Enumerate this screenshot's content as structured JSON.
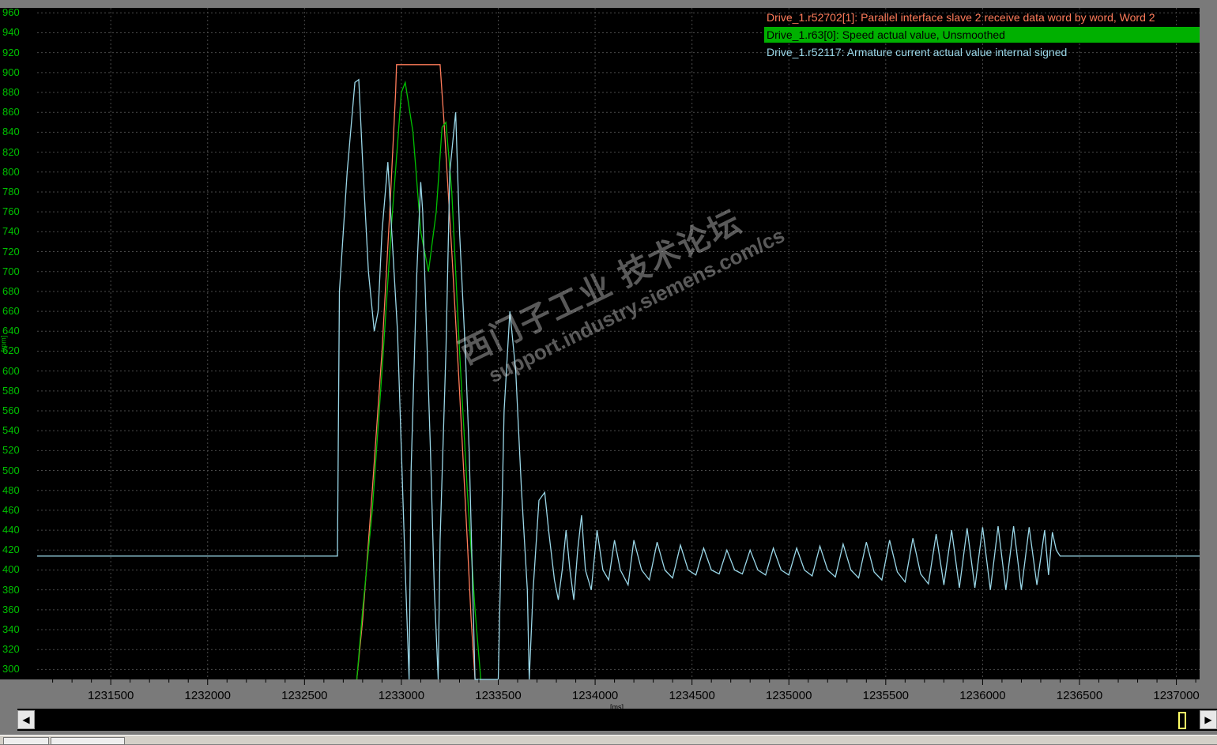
{
  "legend": [
    {
      "label": "Drive_1.r52702[1]: Parallel interface slave 2 receive data word by word, Word 2",
      "color": "#ff7b5a",
      "selected": false
    },
    {
      "label": "Drive_1.r63[0]: Speed actual value, Unsmoothed",
      "color": "#00c000",
      "selected": true
    },
    {
      "label": "Drive_1.r52117: Armature current actual value internal signed",
      "color": "#9ad7e8",
      "selected": false
    }
  ],
  "axes": {
    "y_unit": "[rpm]",
    "x_unit": "[ms]",
    "y_ticks": [
      "960",
      "940",
      "920",
      "900",
      "880",
      "860",
      "840",
      "820",
      "800",
      "780",
      "760",
      "740",
      "720",
      "700",
      "680",
      "660",
      "640",
      "620",
      "600",
      "580",
      "560",
      "540",
      "520",
      "500",
      "480",
      "460",
      "440",
      "420",
      "400",
      "380",
      "360",
      "340",
      "320",
      "300"
    ],
    "x_ticks": [
      "1231500",
      "1232000",
      "1232500",
      "1233000",
      "1233500",
      "1234000",
      "1234500",
      "1235000",
      "1235500",
      "1236000",
      "1236500",
      "1237000"
    ]
  },
  "watermark": {
    "line1": "西门子工业 技术论坛",
    "line2": "support.industry.siemens.com/cs"
  },
  "scrollbar": {
    "left_arrow": "◀",
    "right_arrow": "▶"
  },
  "colors": {
    "plot_bg": "#000000",
    "grid": "#4a4a4a",
    "axis_text": "#00c000",
    "selected_bg": "#00b000"
  },
  "chart_data": {
    "type": "line",
    "xlabel": "[ms]",
    "ylabel": "[rpm]",
    "xlim": [
      1231120,
      1237120
    ],
    "ylim": [
      290,
      965
    ],
    "grid": true,
    "legend_position": "top-right",
    "series": [
      {
        "name": "Drive_1.r52702[1]: Parallel interface slave 2 receive data word by word, Word 2",
        "color": "#ff7b5a",
        "points": [
          [
            1232770,
            290
          ],
          [
            1232800,
            350
          ],
          [
            1232850,
            480
          ],
          [
            1232900,
            620
          ],
          [
            1232940,
            760
          ],
          [
            1232970,
            880
          ],
          [
            1232975,
            908
          ],
          [
            1233000,
            908
          ],
          [
            1233100,
            908
          ],
          [
            1233200,
            908
          ],
          [
            1233220,
            850
          ],
          [
            1233260,
            720
          ],
          [
            1233300,
            580
          ],
          [
            1233340,
            430
          ],
          [
            1233360,
            350
          ],
          [
            1233380,
            290
          ]
        ]
      },
      {
        "name": "Drive_1.r63[0]: Speed actual value, Unsmoothed",
        "color": "#00c000",
        "points": [
          [
            1232770,
            290
          ],
          [
            1232800,
            360
          ],
          [
            1232850,
            460
          ],
          [
            1232900,
            600
          ],
          [
            1232950,
            750
          ],
          [
            1233000,
            880
          ],
          [
            1233020,
            890
          ],
          [
            1233060,
            840
          ],
          [
            1233100,
            740
          ],
          [
            1233140,
            700
          ],
          [
            1233180,
            760
          ],
          [
            1233210,
            845
          ],
          [
            1233230,
            850
          ],
          [
            1233260,
            780
          ],
          [
            1233300,
            620
          ],
          [
            1233340,
            480
          ],
          [
            1233380,
            360
          ],
          [
            1233410,
            290
          ]
        ]
      },
      {
        "name": "Drive_1.r52117: Armature current actual value internal signed",
        "color": "#9ad7e8",
        "points": [
          [
            1231120,
            414
          ],
          [
            1232300,
            414
          ],
          [
            1232670,
            414
          ],
          [
            1232680,
            680
          ],
          [
            1232720,
            800
          ],
          [
            1232760,
            890
          ],
          [
            1232780,
            893
          ],
          [
            1232800,
            810
          ],
          [
            1232830,
            700
          ],
          [
            1232860,
            640
          ],
          [
            1232880,
            660
          ],
          [
            1232900,
            740
          ],
          [
            1232930,
            810
          ],
          [
            1232950,
            740
          ],
          [
            1232980,
            640
          ],
          [
            1233000,
            520
          ],
          [
            1233020,
            400
          ],
          [
            1233040,
            290
          ],
          [
            1233050,
            500
          ],
          [
            1233080,
            700
          ],
          [
            1233100,
            790
          ],
          [
            1233110,
            760
          ],
          [
            1233130,
            640
          ],
          [
            1233150,
            520
          ],
          [
            1233170,
            380
          ],
          [
            1233190,
            290
          ],
          [
            1233200,
            430
          ],
          [
            1233230,
            620
          ],
          [
            1233250,
            800
          ],
          [
            1233280,
            860
          ],
          [
            1233300,
            740
          ],
          [
            1233330,
            620
          ],
          [
            1233350,
            520
          ],
          [
            1233380,
            290
          ],
          [
            1233500,
            290
          ],
          [
            1233530,
            560
          ],
          [
            1233560,
            660
          ],
          [
            1233590,
            600
          ],
          [
            1233620,
            480
          ],
          [
            1233650,
            380
          ],
          [
            1233660,
            290
          ],
          [
            1233680,
            380
          ],
          [
            1233710,
            470
          ],
          [
            1233740,
            478
          ],
          [
            1233760,
            440
          ],
          [
            1233790,
            390
          ],
          [
            1233810,
            370
          ],
          [
            1233830,
            400
          ],
          [
            1233850,
            440
          ],
          [
            1233870,
            400
          ],
          [
            1233890,
            370
          ],
          [
            1233910,
            420
          ],
          [
            1233930,
            455
          ],
          [
            1233950,
            400
          ],
          [
            1233980,
            380
          ],
          [
            1234010,
            440
          ],
          [
            1234040,
            400
          ],
          [
            1234070,
            390
          ],
          [
            1234100,
            430
          ],
          [
            1234130,
            400
          ],
          [
            1234170,
            385
          ],
          [
            1234200,
            430
          ],
          [
            1234240,
            400
          ],
          [
            1234280,
            390
          ],
          [
            1234320,
            428
          ],
          [
            1234360,
            400
          ],
          [
            1234400,
            392
          ],
          [
            1234440,
            425
          ],
          [
            1234480,
            400
          ],
          [
            1234520,
            395
          ],
          [
            1234560,
            422
          ],
          [
            1234600,
            400
          ],
          [
            1234640,
            396
          ],
          [
            1234680,
            420
          ],
          [
            1234720,
            400
          ],
          [
            1234760,
            396
          ],
          [
            1234800,
            420
          ],
          [
            1234840,
            400
          ],
          [
            1234880,
            395
          ],
          [
            1234920,
            422
          ],
          [
            1234960,
            400
          ],
          [
            1235000,
            395
          ],
          [
            1235040,
            422
          ],
          [
            1235080,
            400
          ],
          [
            1235120,
            394
          ],
          [
            1235160,
            424
          ],
          [
            1235200,
            400
          ],
          [
            1235240,
            393
          ],
          [
            1235280,
            426
          ],
          [
            1235320,
            400
          ],
          [
            1235360,
            392
          ],
          [
            1235400,
            428
          ],
          [
            1235440,
            398
          ],
          [
            1235480,
            390
          ],
          [
            1235520,
            430
          ],
          [
            1235560,
            398
          ],
          [
            1235600,
            388
          ],
          [
            1235640,
            432
          ],
          [
            1235680,
            396
          ],
          [
            1235720,
            386
          ],
          [
            1235760,
            436
          ],
          [
            1235800,
            385
          ],
          [
            1235840,
            440
          ],
          [
            1235880,
            382
          ],
          [
            1235920,
            442
          ],
          [
            1235960,
            382
          ],
          [
            1236000,
            443
          ],
          [
            1236040,
            380
          ],
          [
            1236080,
            444
          ],
          [
            1236120,
            380
          ],
          [
            1236160,
            444
          ],
          [
            1236200,
            380
          ],
          [
            1236240,
            443
          ],
          [
            1236280,
            385
          ],
          [
            1236320,
            440
          ],
          [
            1236340,
            395
          ],
          [
            1236360,
            438
          ],
          [
            1236380,
            420
          ],
          [
            1236400,
            414
          ],
          [
            1237120,
            414
          ]
        ]
      }
    ]
  }
}
